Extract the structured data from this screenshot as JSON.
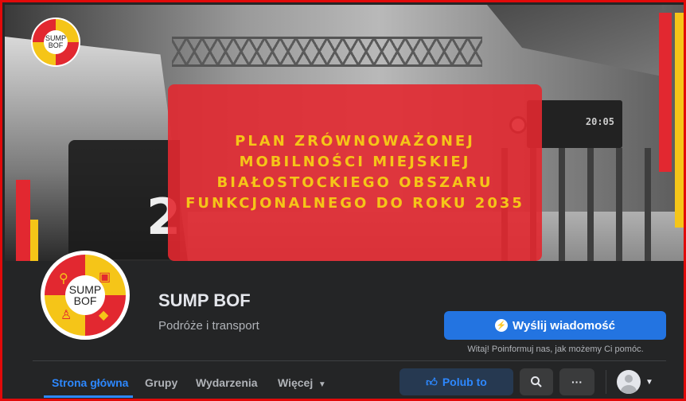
{
  "colors": {
    "brand_red": "#e22830",
    "brand_yellow": "#f5c518",
    "facebook_blue": "#2374e1",
    "background_dark": "#242526"
  },
  "cover": {
    "title": "PLAN ZRÓWNOWAŻONEJ MOBILNOŚCI MIEJSKIEJ BIAŁOSTOCKIEGO OBSZARU FUNKCJONALNEGO DO ROKU 2035",
    "train_number": "2",
    "board_time": "20:05"
  },
  "logo": {
    "line1": "SUMP",
    "line2": "BOF",
    "icons": [
      "bicycle-icon",
      "bus-icon",
      "walking-icon",
      "car-icon"
    ]
  },
  "profile": {
    "name": "SUMP BOF",
    "category": "Podróże i transport"
  },
  "actions": {
    "message_button": "Wyślij wiadomość",
    "message_hint": "Witaj! Poinformuj nas, jak możemy Ci pomóc.",
    "like_button": "Polub to",
    "more_button": "···"
  },
  "tabs": [
    {
      "label": "Strona główna",
      "active": true
    },
    {
      "label": "Grupy"
    },
    {
      "label": "Wydarzenia"
    },
    {
      "label": "Więcej"
    }
  ]
}
